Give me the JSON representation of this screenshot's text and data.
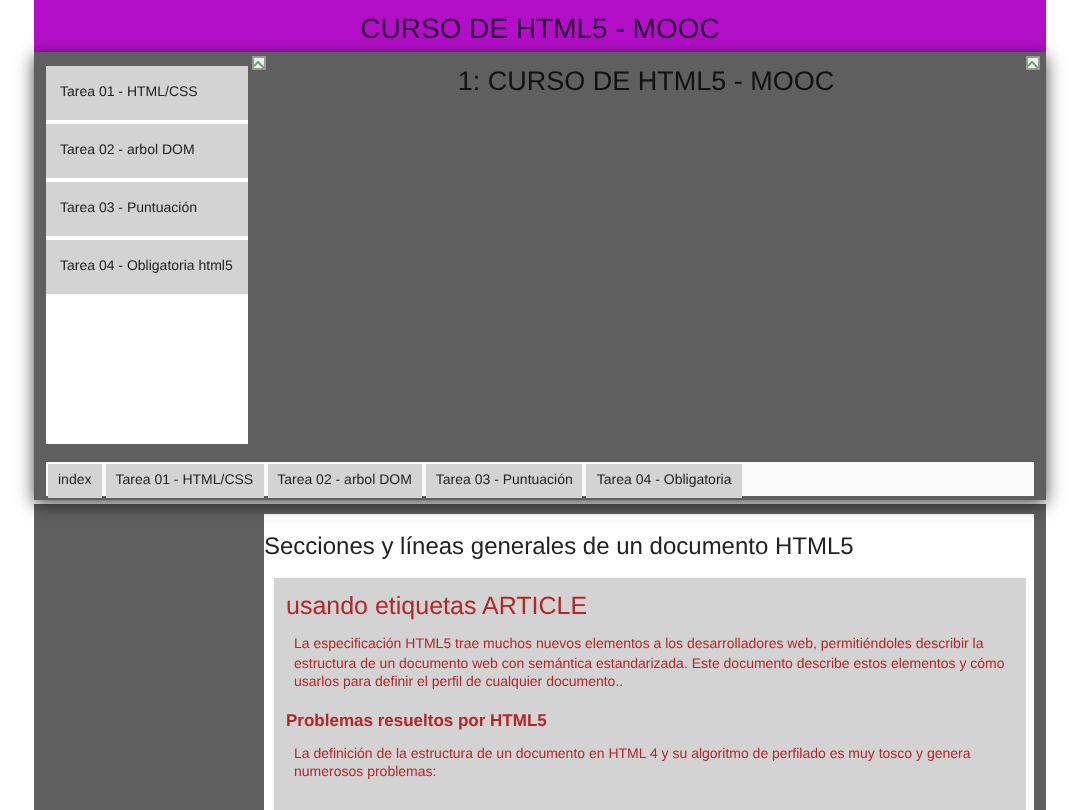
{
  "header": {
    "title": "CURSO DE HTML5 - MOOC"
  },
  "sidebar": {
    "items": [
      {
        "label": "Tarea 01 - HTML/CSS"
      },
      {
        "label": "Tarea 02 - arbol DOM"
      },
      {
        "label": "Tarea 03 - Puntuación"
      },
      {
        "label": "Tarea 04 - Obligatoria html5"
      }
    ]
  },
  "banner": {
    "title": "1: CURSO DE HTML5 - MOOC"
  },
  "tabs": [
    {
      "label": "index"
    },
    {
      "label": "Tarea 01 - HTML/CSS"
    },
    {
      "label": "Tarea 02 - arbol DOM"
    },
    {
      "label": "Tarea 03 - Puntuación"
    },
    {
      "label": "Tarea 04 - Obligatoria"
    }
  ],
  "content": {
    "heading": "Secciones y líneas generales de un documento HTML5",
    "article": {
      "title": "usando etiquetas ARTICLE",
      "blocks": [
        {
          "kind": "paragraph",
          "text": "La especificación HTML5 trae muchos nuevos elementos a los desarrolladores web, permitiéndoles describir la estructura de un documento web con semántica estandarizada. Este documento describe estos elementos y cómo usarlos para definir el perfil de cualquier documento.."
        },
        {
          "kind": "subheading",
          "text": "Problemas resueltos por HTML5"
        },
        {
          "kind": "paragraph",
          "text": "La definición de la estructura de un documento en HTML 4 y su algoritmo de perfilado es muy tosco y genera numerosos problemas:"
        }
      ]
    }
  }
}
